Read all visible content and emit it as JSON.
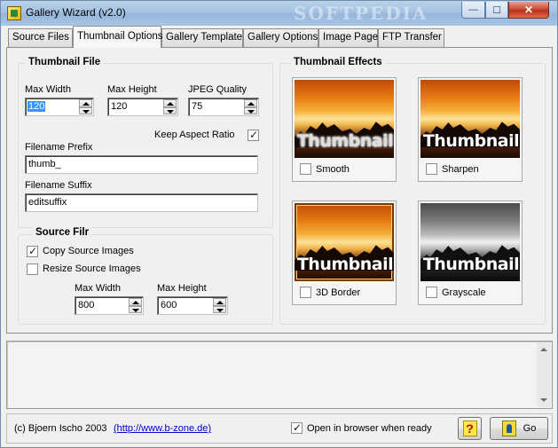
{
  "window": {
    "title": "Gallery Wizard (v2.0)",
    "watermark": "SOFTPEDIA",
    "minimize_glyph": "—",
    "maximize_glyph": "☐",
    "close_glyph": "✕"
  },
  "tabs": [
    {
      "label": "Source Files",
      "active": false
    },
    {
      "label": "Thumbnail Options",
      "active": true
    },
    {
      "label": "Gallery Template",
      "active": false
    },
    {
      "label": "Gallery Options",
      "active": false
    },
    {
      "label": "Image Page",
      "active": false
    },
    {
      "label": "FTP Transfer",
      "active": false
    }
  ],
  "thumbnail_file": {
    "title": "Thumbnail File",
    "max_width_label": "Max Width",
    "max_width": "120",
    "max_height_label": "Max Height",
    "max_height": "120",
    "jpeg_quality_label": "JPEG Quality",
    "jpeg_quality": "75",
    "keep_aspect_label": "Keep Aspect Ratio",
    "keep_aspect_checked": true,
    "prefix_label": "Filename Prefix",
    "prefix_value": "thumb_",
    "suffix_label": "Filename Suffix",
    "suffix_value": "editsuffix"
  },
  "source_file": {
    "title": "Source Filr",
    "copy_label": "Copy Source Images",
    "copy_checked": true,
    "resize_label": "Resize Source Images",
    "resize_checked": false,
    "max_width_label": "Max Width",
    "max_width": "800",
    "max_height_label": "Max Height",
    "max_height": "600"
  },
  "effects": {
    "title": "Thumbnail Effects",
    "preview_text": "Thumbnail",
    "items": [
      {
        "label": "Smooth",
        "checked": false,
        "icon": "smooth-preview-image"
      },
      {
        "label": "Sharpen",
        "checked": false,
        "icon": "sharpen-preview-image"
      },
      {
        "label": "3D Border",
        "checked": false,
        "icon": "3d-border-preview-image"
      },
      {
        "label": "Grayscale",
        "checked": false,
        "icon": "grayscale-preview-image"
      }
    ]
  },
  "footer": {
    "copyright": "(c) Bjoern Ischo 2003",
    "link": "(http://www.b-zone.de)",
    "open_browser_label": "Open in browser when ready",
    "open_browser_checked": true,
    "help_glyph": "?",
    "go_label": "Go"
  },
  "colors": {
    "selection": "#3399ff",
    "link": "#0000cc",
    "close_button": "#c7442c"
  }
}
